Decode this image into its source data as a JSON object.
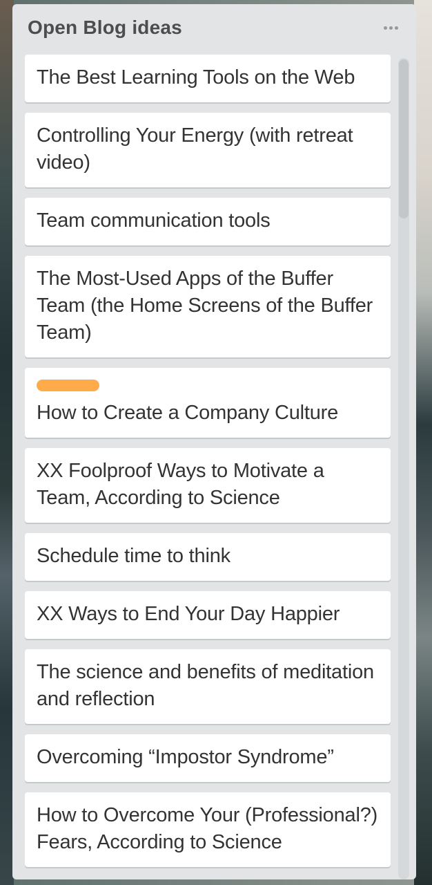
{
  "list": {
    "title": "Open Blog ideas",
    "menu_icon": "ellipsis-icon"
  },
  "colors": {
    "list_background": "#e2e4e6",
    "card_background": "#ffffff",
    "label_orange": "#ffab4a",
    "text": "#333333"
  },
  "cards": [
    {
      "title": "The Best Learning Tools on the Web"
    },
    {
      "title": "Controlling Your Energy (with retreat video)"
    },
    {
      "title": "Team communication tools"
    },
    {
      "title": "The Most-Used Apps of the Buffer Team (the Home Screens of the Buffer Team)"
    },
    {
      "title": "How to Create a Company Culture",
      "label_color": "#ffab4a"
    },
    {
      "title": "XX Foolproof Ways to Motivate a Team, According to Science"
    },
    {
      "title": "Schedule time to think"
    },
    {
      "title": "XX Ways to End Your Day Happier"
    },
    {
      "title": "The science and benefits of meditation and reflection"
    },
    {
      "title": "Overcoming “Impostor Syndrome”"
    },
    {
      "title": "How to Overcome Your (Professional?) Fears, According to Science"
    }
  ]
}
